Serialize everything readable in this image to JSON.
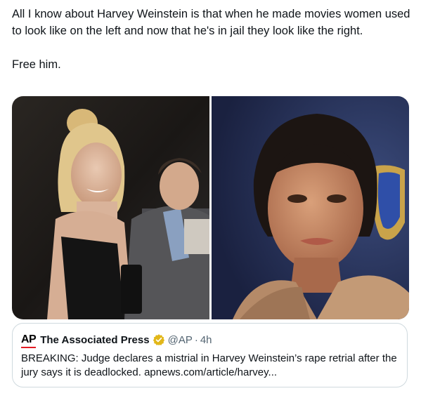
{
  "tweet": {
    "text": "All I know about Harvey Weinstein is that when he made movies women used to look like on the left and now that he's in jail they look like the right.\n\nFree him."
  },
  "media": {
    "images": [
      {
        "alt": "photo-left"
      },
      {
        "alt": "photo-right"
      }
    ]
  },
  "quote": {
    "logo": "AP",
    "name": "The Associated Press",
    "handle": "@AP",
    "separator": "·",
    "time": "4h",
    "body": "BREAKING: Judge declares a mistrial in Harvey Weinstein’s rape retrial after the jury says it is deadlocked. apnews.com/article/harvey..."
  },
  "colors": {
    "text_primary": "#0f1419",
    "text_secondary": "#536471",
    "border": "#cfd9de",
    "verified_gold": "#e2b719",
    "ap_red": "#e31b23"
  }
}
